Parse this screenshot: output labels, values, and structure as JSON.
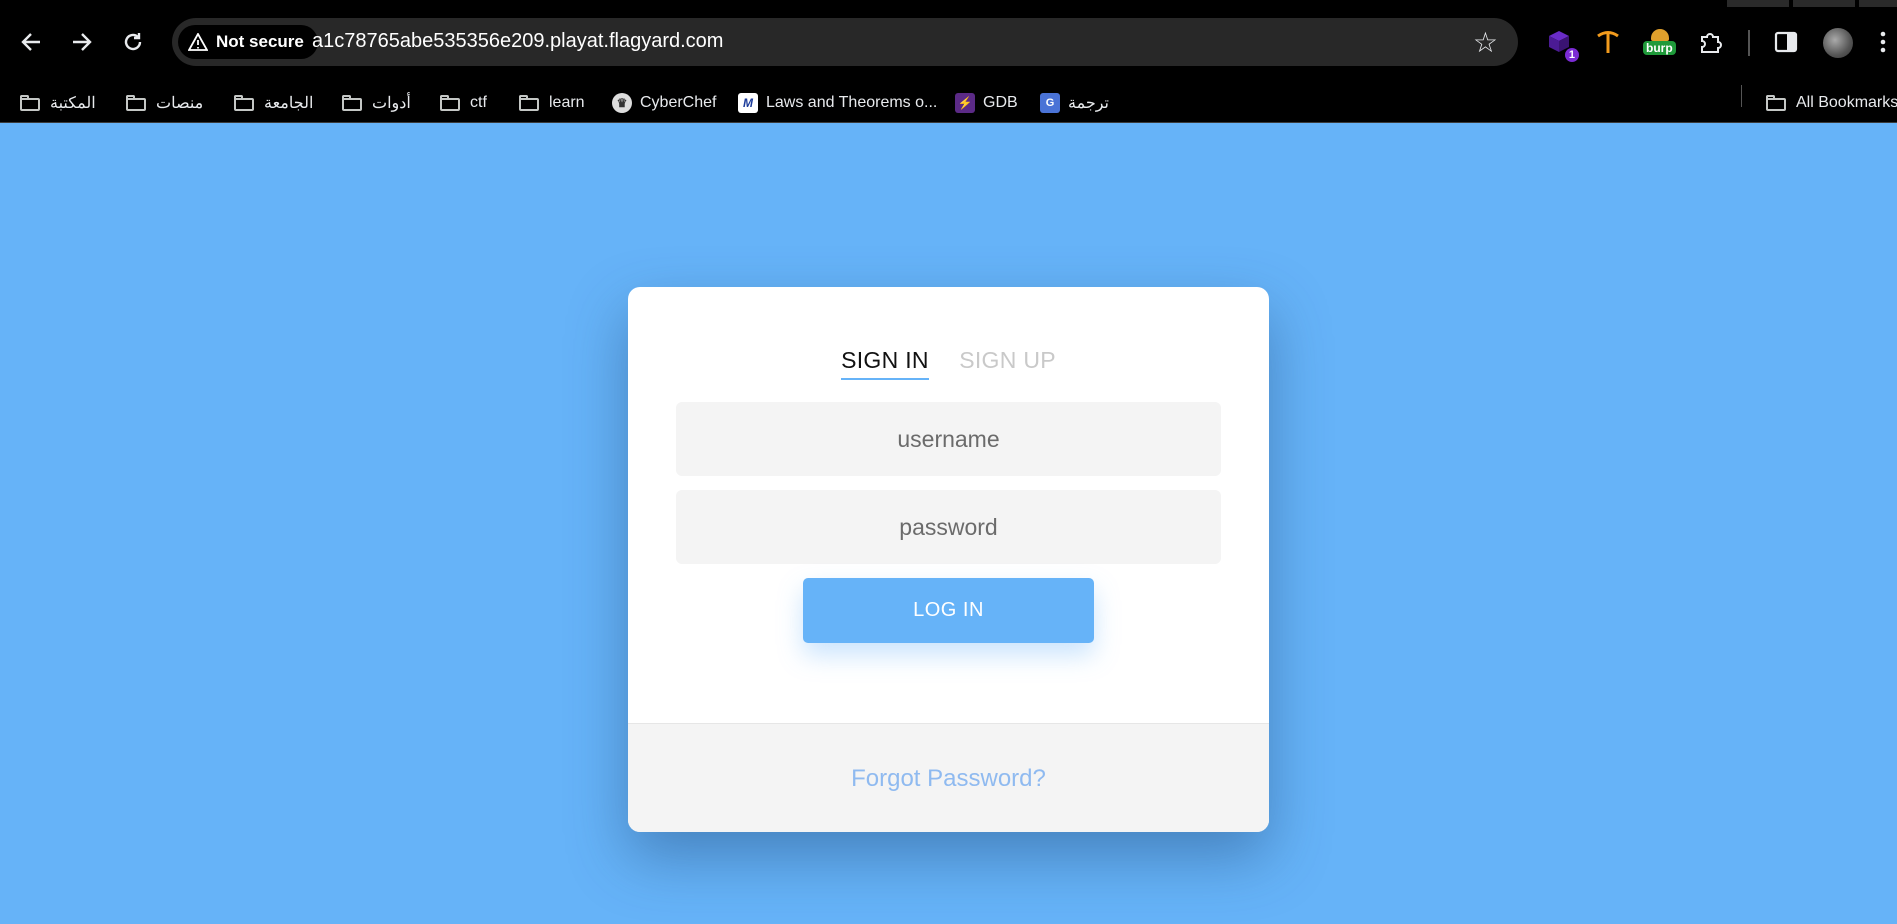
{
  "browser": {
    "security_label": "Not secure",
    "url": "a1c78765abe535356e209.playat.flagyard.com",
    "extension_badge": "1",
    "burp_label": "burp"
  },
  "bookmarks": {
    "items": [
      "المكتبة",
      "منصات",
      "الجامعة",
      "أدوات",
      "ctf",
      "learn",
      "CyberChef",
      "Laws and Theorems o...",
      "GDB",
      "ترجمة"
    ],
    "all_bookmarks": "All Bookmarks"
  },
  "login": {
    "tab_sign_in": "SIGN IN",
    "tab_sign_up": "SIGN UP",
    "username_placeholder": "username",
    "password_placeholder": "password",
    "login_button": "LOG IN",
    "forgot_password": "Forgot Password?"
  },
  "colors": {
    "page_background": "#66b3f8",
    "accent": "#66b3f8",
    "link": "#8fbaf0"
  }
}
